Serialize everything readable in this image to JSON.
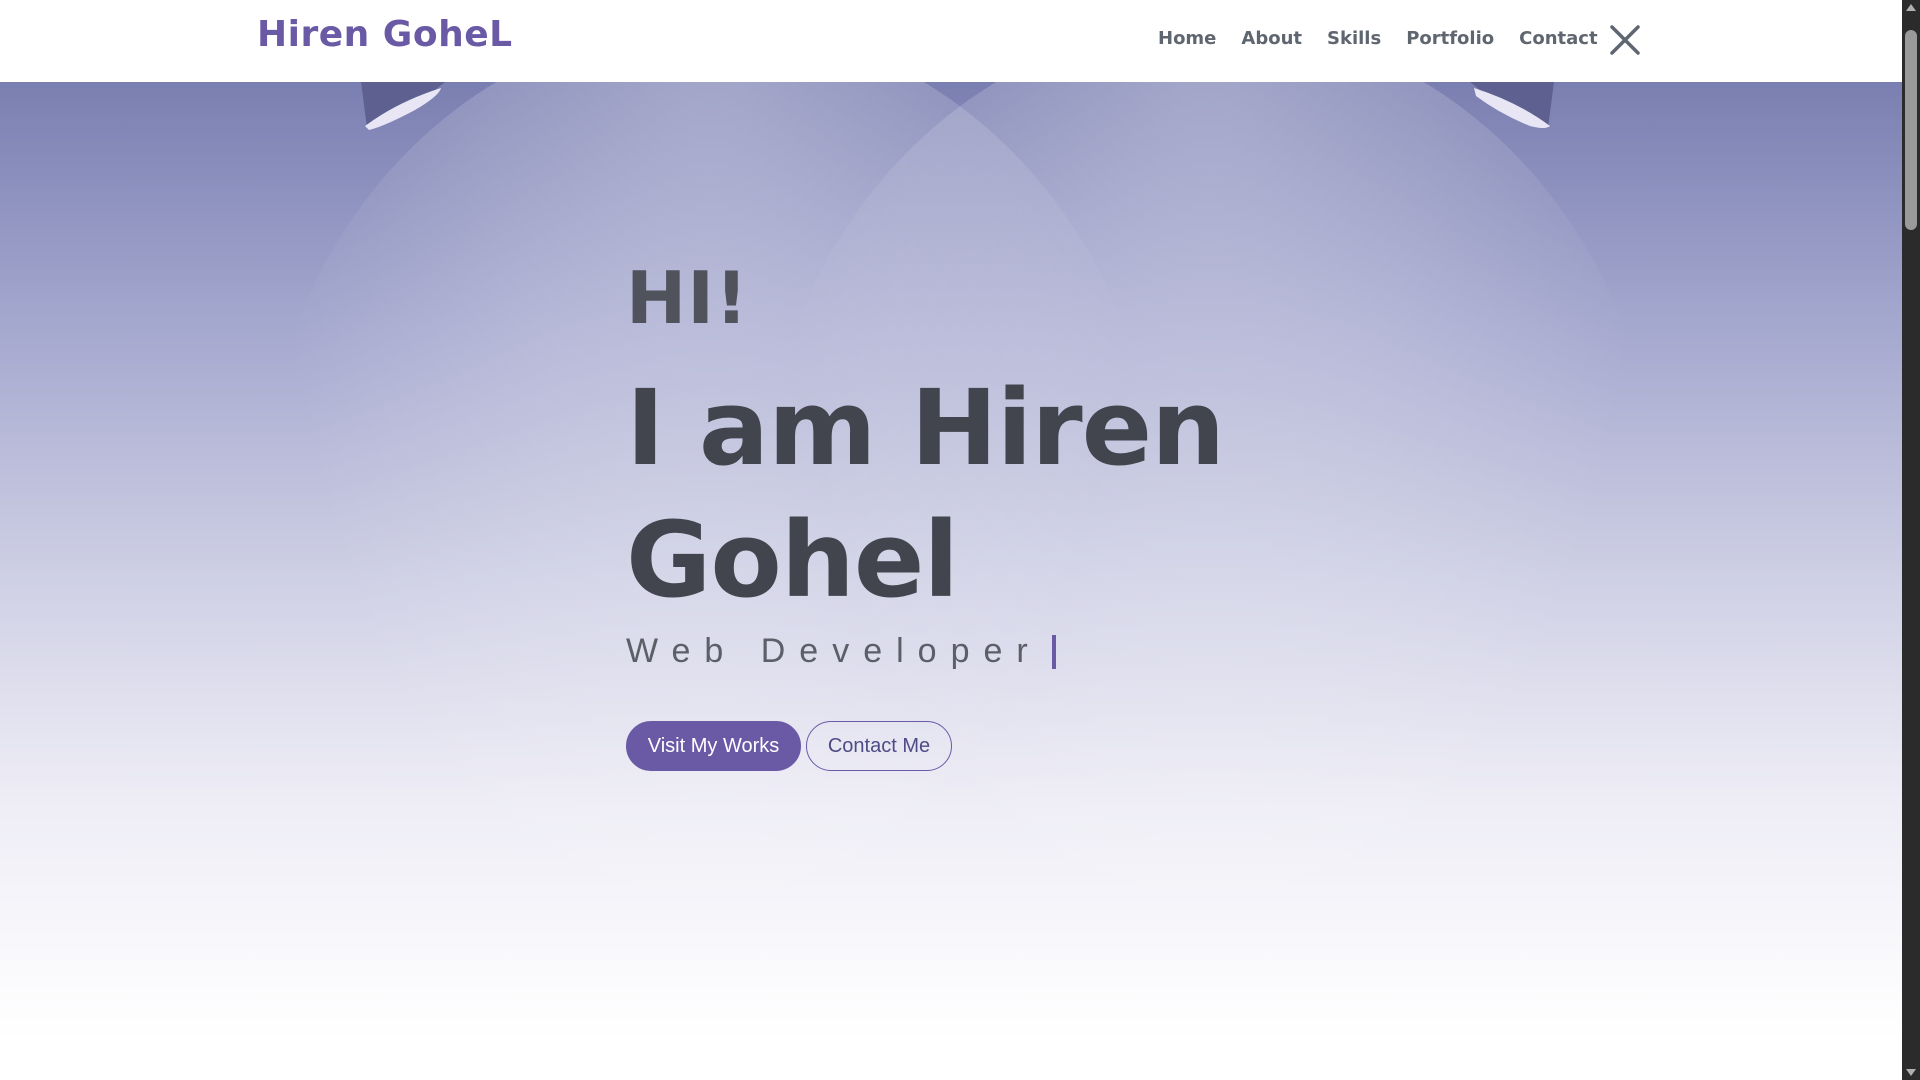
{
  "header": {
    "logo": "Hiren GoheL",
    "nav": [
      {
        "label": "Home"
      },
      {
        "label": "About"
      },
      {
        "label": "Skills"
      },
      {
        "label": "Portfolio"
      },
      {
        "label": "Contact"
      }
    ],
    "close_icon": "close-x-icon"
  },
  "hero": {
    "greeting": "HI!",
    "headline_line1": "I am Hiren",
    "headline_line2": "Gohel",
    "subtitle": "Web Developer",
    "primary_button": "Visit My Works",
    "secondary_button": "Contact Me"
  },
  "colors": {
    "accent": "#6a5aa6",
    "text_dark": "#42454e",
    "nav_text": "#5f6670"
  }
}
